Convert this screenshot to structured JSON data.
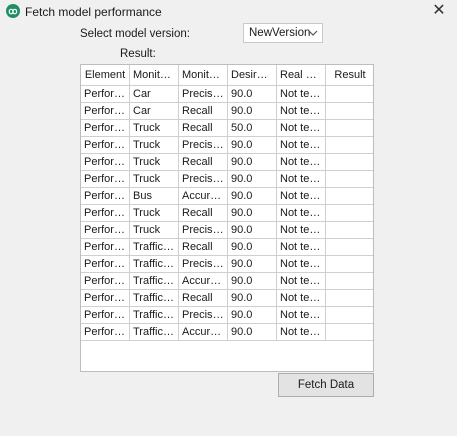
{
  "window": {
    "title": "Fetch model performance",
    "icon": "app-logo-icon",
    "close_glyph": "✕"
  },
  "form": {
    "select_label": "Select model version:",
    "selected_version": "NewVersion",
    "result_label": "Result:"
  },
  "table": {
    "headers": [
      "Element",
      "Monitor...",
      "Monitor...",
      "Desired ...",
      "Real Val...",
      "Result"
    ],
    "rows": [
      [
        "Perform...",
        "Car",
        "Precision",
        "90.0",
        "Not test...",
        ""
      ],
      [
        "Perform...",
        "Car",
        "Recall",
        "90.0",
        "Not test...",
        ""
      ],
      [
        "Perform...",
        "Truck",
        "Recall",
        "50.0",
        "Not test...",
        ""
      ],
      [
        "Perform...",
        "Truck",
        "Precision",
        "90.0",
        "Not test...",
        ""
      ],
      [
        "Perform...",
        "Truck",
        "Recall",
        "90.0",
        "Not test...",
        ""
      ],
      [
        "Perform...",
        "Truck",
        "Precision",
        "90.0",
        "Not test...",
        ""
      ],
      [
        "Perform...",
        "Bus",
        "Accuracy",
        "90.0",
        "Not test...",
        ""
      ],
      [
        "Perform...",
        "Truck",
        "Recall",
        "90.0",
        "Not test...",
        ""
      ],
      [
        "Perform...",
        "Truck",
        "Precision",
        "90.0",
        "Not test...",
        ""
      ],
      [
        "Perform...",
        "Traffic si...",
        "Recall",
        "90.0",
        "Not test...",
        ""
      ],
      [
        "Perform...",
        "Traffic si...",
        "Precision",
        "90.0",
        "Not test...",
        ""
      ],
      [
        "Perform...",
        "Traffic si...",
        "Accuracy",
        "90.0",
        "Not test...",
        ""
      ],
      [
        "Perform...",
        "Traffic li...",
        "Recall",
        "90.0",
        "Not test...",
        ""
      ],
      [
        "Perform...",
        "Traffic li...",
        "Precision",
        "90.0",
        "Not test...",
        ""
      ],
      [
        "Perform...",
        "Traffic li...",
        "Accuracy",
        "90.0",
        "Not test...",
        ""
      ]
    ]
  },
  "buttons": {
    "fetch_label": "Fetch Data"
  }
}
